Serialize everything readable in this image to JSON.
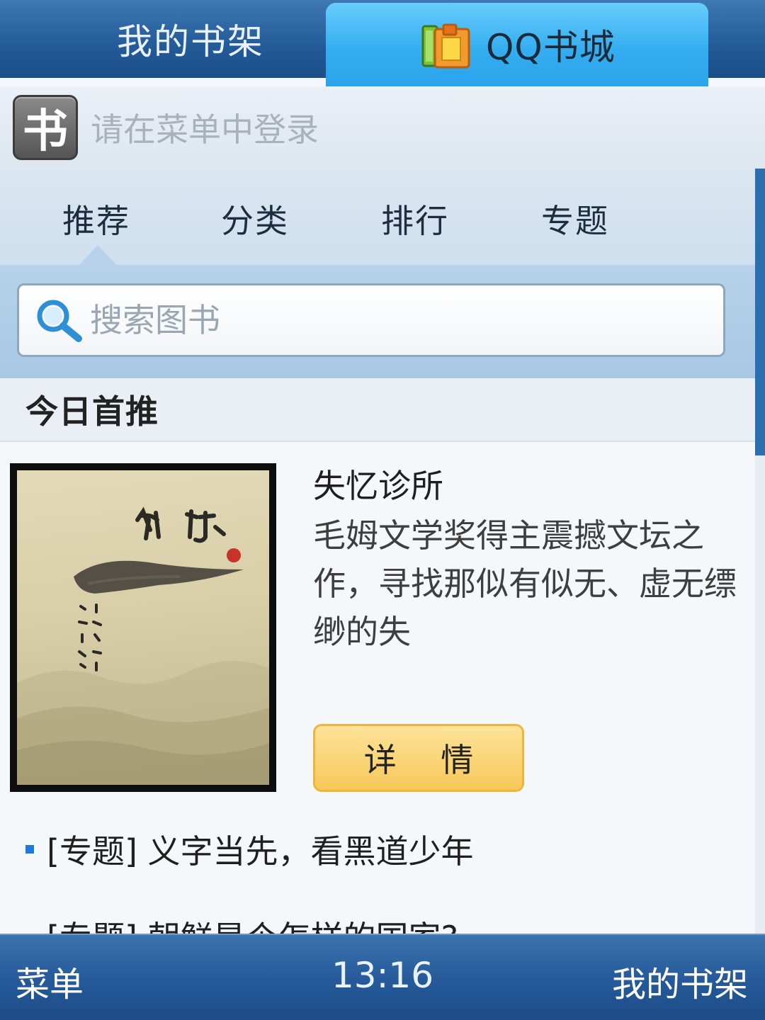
{
  "top_tabs": {
    "shelf_label": "我的书架",
    "store_label": "QQ书城",
    "store_icon": "book-stack-icon"
  },
  "login_bar": {
    "icon_char": "书",
    "text": "请在菜单中登录"
  },
  "sub_nav": {
    "items": [
      "推荐",
      "分类",
      "排行",
      "专题"
    ],
    "active_index": 0
  },
  "search": {
    "placeholder": "搜索图书",
    "icon": "search-icon"
  },
  "section": {
    "title": "今日首推"
  },
  "featured_book": {
    "title": "失忆诊所",
    "description": "毛姆文学奖得主震撼文坛之作，寻找那似有似无、虚无缥缈的失",
    "detail_button": "详 情"
  },
  "topics": [
    "[专题] 义字当先，看黑道少年",
    "[专题] 朝鲜是个怎样的国家?"
  ],
  "softkeys": {
    "left": "菜单",
    "time": "13:16",
    "right": "我的书架"
  },
  "colors": {
    "top_bar": "#235a98",
    "active_tab": "#35aef0",
    "detail_button": "#f7c85a",
    "bullet": "#1f79d8",
    "scrollbar": "#2b6fb0"
  }
}
